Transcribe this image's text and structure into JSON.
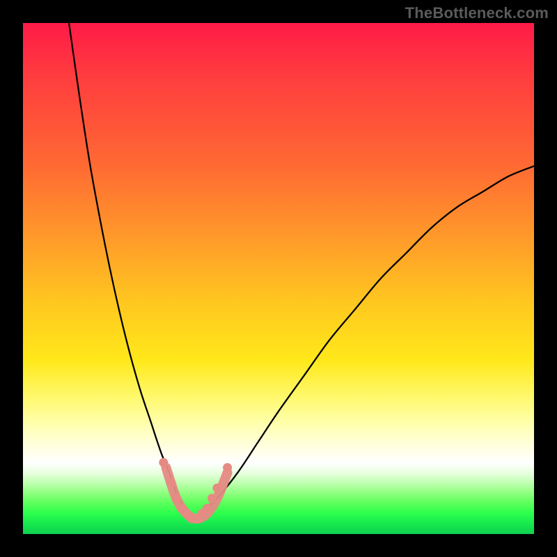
{
  "watermark": "TheBottleneck.com",
  "chart_data": {
    "type": "line",
    "title": "",
    "xlabel": "",
    "ylabel": "",
    "xlim": [
      0,
      100
    ],
    "ylim": [
      0,
      100
    ],
    "grid": false,
    "legend": false,
    "notes": "Unlabeled bottleneck-style curve. Two black curves descend from top toward a minimum near x≈33 at y≈3; left branch originates at top-left corner (x≈9, y=100), right branch exits near top-right edge (x≈100, y≈72). A salmon-colored dotted/thick segment highlights the trough between x≈28 and x≈40. Background is a vertical spectral gradient (red→green) inside a black frame.",
    "series": [
      {
        "name": "left-branch",
        "x": [
          9,
          11,
          13,
          15,
          17,
          19,
          21,
          23,
          25,
          27,
          29,
          30,
          31,
          32,
          33
        ],
        "values": [
          100,
          86,
          73,
          62,
          52,
          43,
          35,
          28,
          22,
          16,
          11,
          8,
          6,
          4,
          3
        ]
      },
      {
        "name": "right-branch",
        "x": [
          33,
          35,
          38,
          42,
          46,
          50,
          55,
          60,
          65,
          70,
          75,
          80,
          85,
          90,
          95,
          100
        ],
        "values": [
          3,
          4,
          7,
          12,
          18,
          24,
          31,
          38,
          44,
          50,
          55,
          60,
          64,
          67,
          70,
          72
        ]
      },
      {
        "name": "trough-highlight",
        "style": "salmon-thick-dotted",
        "x": [
          28,
          30,
          32,
          34,
          36,
          38,
          40
        ],
        "values": [
          13,
          7,
          4,
          3,
          4,
          7,
          12
        ]
      }
    ],
    "highlight_dots": {
      "color": "#e68a84",
      "points_x": [
        27.5,
        29,
        30,
        31,
        32,
        33,
        34,
        35,
        36,
        37,
        38,
        40
      ],
      "points_y": [
        14,
        10,
        7,
        5,
        4,
        3,
        3,
        4,
        5,
        7,
        9,
        13
      ]
    }
  }
}
